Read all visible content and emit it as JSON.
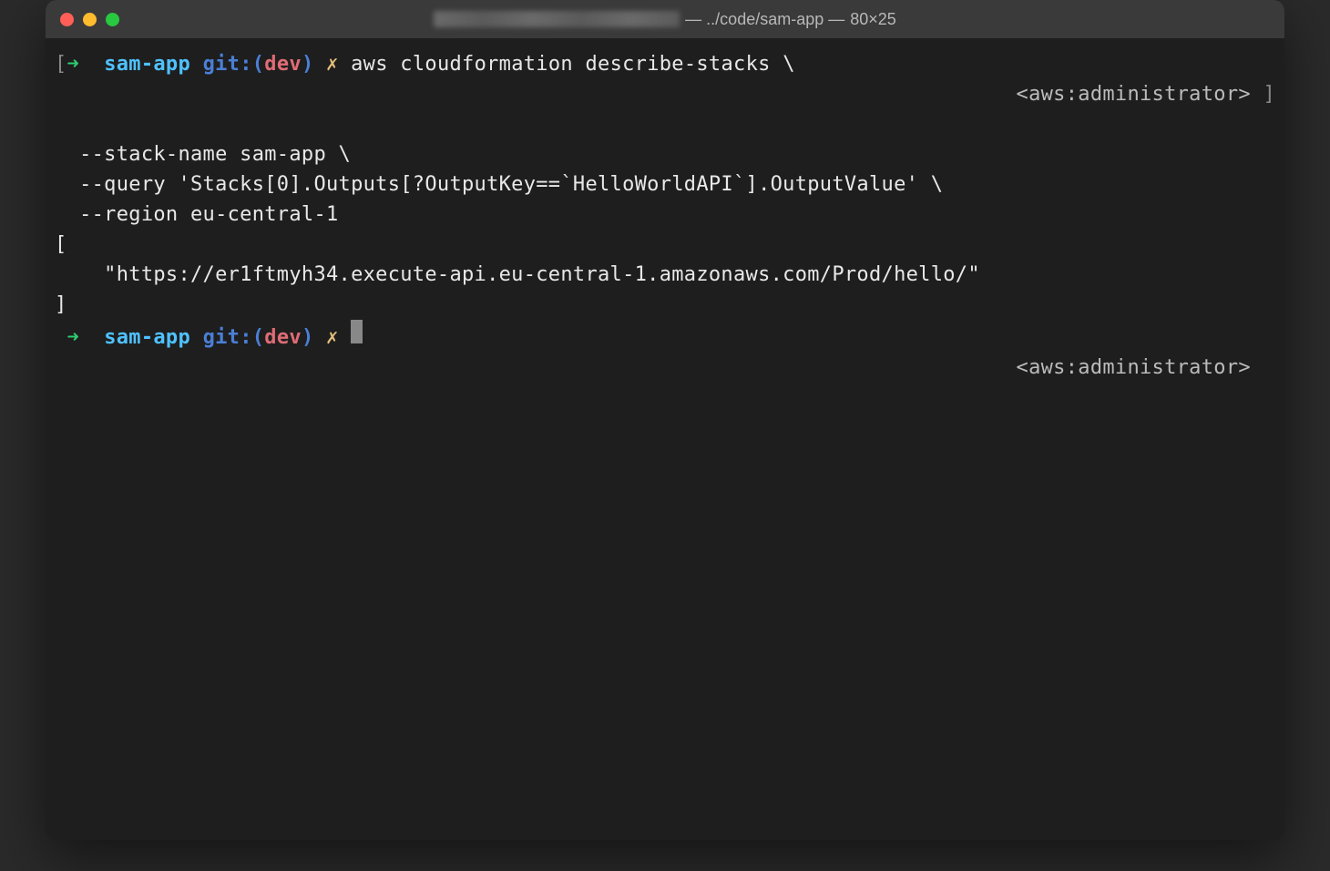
{
  "window": {
    "title_path": " — ../code/sam-app — ",
    "title_dims": "80×25"
  },
  "prompt": {
    "open_bracket": "[",
    "close_bracket": "]",
    "arrow": "➜",
    "dir": "sam-app",
    "git_label": "git:",
    "open_paren": "(",
    "branch": "dev",
    "close_paren": ")",
    "dirty_mark": "✗",
    "aws_badge": "<aws:administrator>"
  },
  "command": {
    "line1": "aws cloudformation describe-stacks \\",
    "line2": "  --stack-name sam-app \\",
    "line3": "  --query 'Stacks[0].Outputs[?OutputKey==`HelloWorldAPI`].OutputValue' \\",
    "line4": "  --region eu-central-1"
  },
  "output": {
    "open": "[",
    "value": "    \"https://er1ftmyh34.execute-api.eu-central-1.amazonaws.com/Prod/hello/\"",
    "close": "]"
  }
}
